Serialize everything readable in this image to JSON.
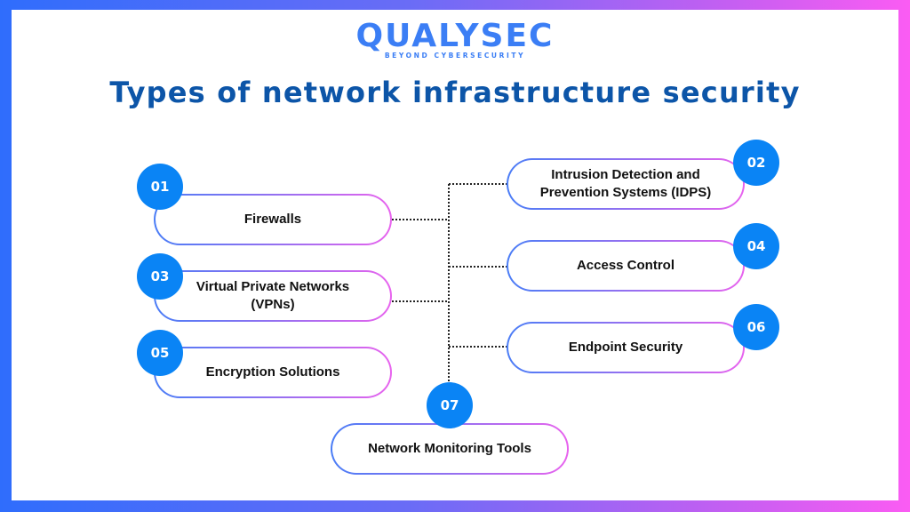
{
  "logo": {
    "wordmark": "QUALYSEC",
    "tagline": "BEYOND CYBERSECURITY"
  },
  "title": "Types of network infrastructure security",
  "colors": {
    "badge": "#0a84f5",
    "title": "#0c55a8",
    "logo": "#3b7ef5",
    "gradient_start": "#2f6dfc",
    "gradient_end": "#fb5cf3"
  },
  "items": [
    {
      "number": "01",
      "label": "Firewalls"
    },
    {
      "number": "02",
      "label": "Intrusion Detection and Prevention Systems (IDPS)"
    },
    {
      "number": "03",
      "label": "Virtual Private Networks (VPNs)"
    },
    {
      "number": "04",
      "label": "Access Control"
    },
    {
      "number": "05",
      "label": "Encryption Solutions"
    },
    {
      "number": "06",
      "label": "Endpoint Security"
    },
    {
      "number": "07",
      "label": "Network Monitoring Tools"
    }
  ]
}
